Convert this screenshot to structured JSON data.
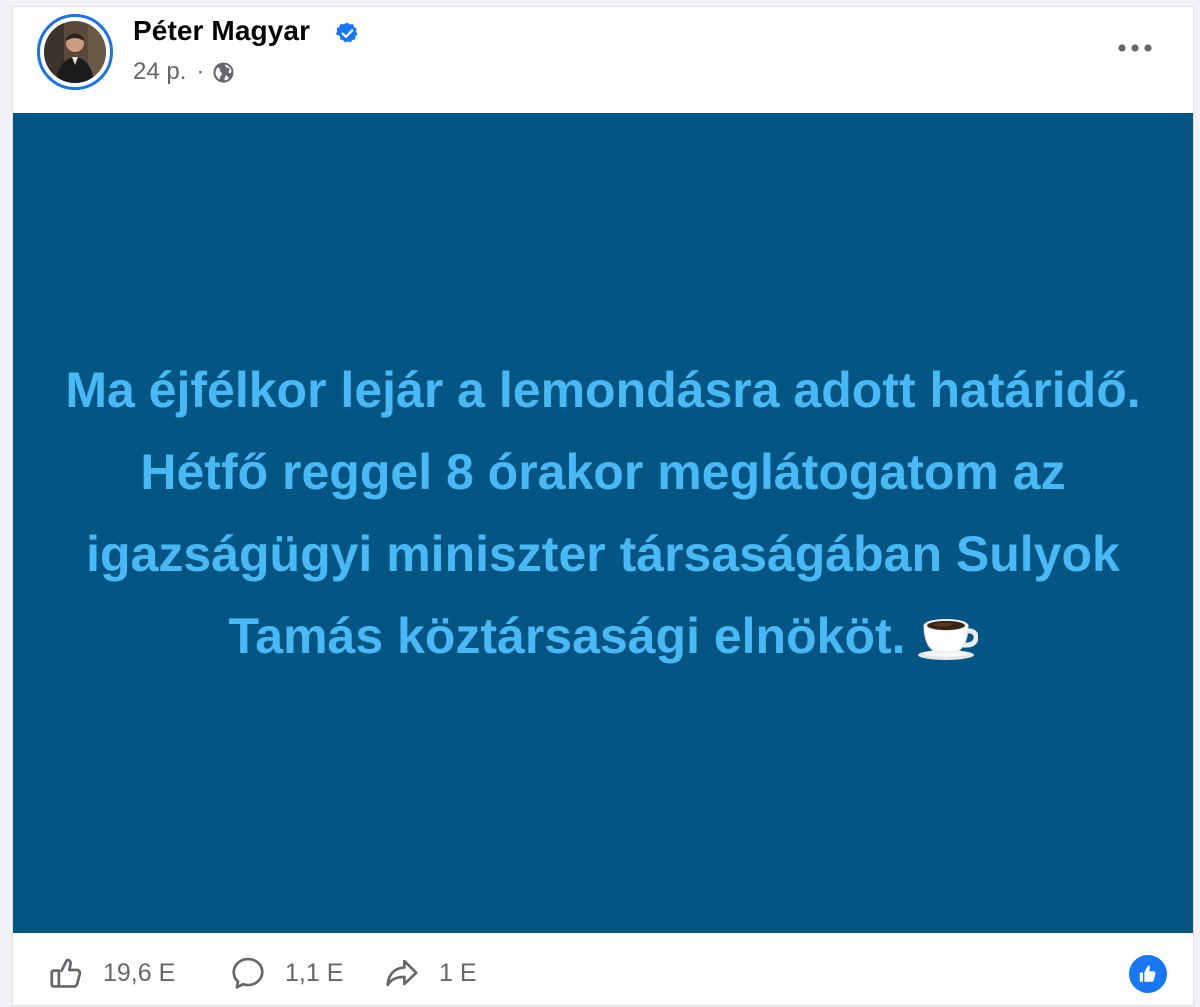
{
  "post": {
    "author": {
      "name": "Péter Magyar",
      "verified": true
    },
    "meta": {
      "time": "24 p.",
      "separator": "·",
      "audience_icon": "globe-icon"
    },
    "more_icon": "more-options-icon",
    "body": {
      "text": "Ma éjfélkor lejár a lemondásra adott határidő. Hétfő reggel 8 órakor meglátogatom az igazságügyi miniszter társaságában Sulyok Tamás köztársasági elnököt.",
      "emoji_icon": "coffee-cup-icon",
      "background_color": "#035584",
      "text_color": "#49b9f5"
    },
    "actions": {
      "like": {
        "icon": "like-icon",
        "count": "19,6 E"
      },
      "comment": {
        "icon": "comment-icon",
        "count": "1,1 E"
      },
      "share": {
        "icon": "share-icon",
        "count": "1 E"
      }
    },
    "reaction_badge_icon": "like-reaction-badge-icon",
    "colors": {
      "accent": "#1877f2",
      "muted_text": "#65676b",
      "name_text": "#050505"
    }
  }
}
